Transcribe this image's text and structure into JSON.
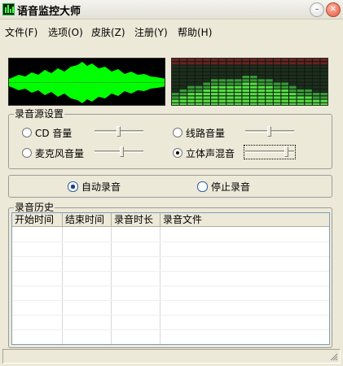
{
  "window": {
    "title": "语音监控大师",
    "minimize_icon": "minimize-icon",
    "close_icon": "close-icon"
  },
  "menu": [
    {
      "label": "文件(F)"
    },
    {
      "label": "选项(O)"
    },
    {
      "label": "皮肤(Z)"
    },
    {
      "label": "注册(Y)"
    },
    {
      "label": "帮助(H)"
    }
  ],
  "source": {
    "title": "录音源设置",
    "options": [
      {
        "label": "CD 音量",
        "checked": false,
        "level": 0.5
      },
      {
        "label": "线路音量",
        "checked": false,
        "level": 0.5
      },
      {
        "label": "麦克风音量",
        "checked": false,
        "level": 0.55
      },
      {
        "label": "立体声混音",
        "checked": true,
        "level": 0.8
      }
    ]
  },
  "recording": {
    "auto_label": "自动录音",
    "stop_label": "停止录音",
    "selected": "auto"
  },
  "history": {
    "title": "录音历史",
    "columns": [
      "开始时间",
      "结束时间",
      "录音时长",
      "录音文件"
    ],
    "rows": []
  },
  "colors": {
    "waveform": "#00ff00",
    "eq_bars": "#55dd44",
    "eq_peak": "#6b2222"
  }
}
